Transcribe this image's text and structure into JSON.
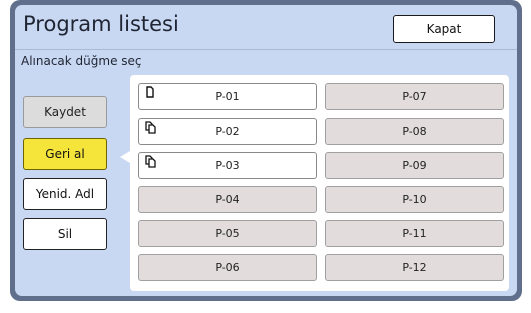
{
  "header": {
    "title": "Program listesi",
    "close_label": "Kapat"
  },
  "instruction": "Alınacak düğme seç",
  "actions": [
    {
      "label": "Kaydet",
      "state": "disabled"
    },
    {
      "label": "Geri al",
      "state": "active"
    },
    {
      "label": "Yenid. Adl",
      "state": "normal"
    },
    {
      "label": "Sil",
      "state": "normal"
    }
  ],
  "programs": [
    {
      "label": "P-01",
      "icon": "single-page-icon"
    },
    {
      "label": "P-02",
      "icon": "multi-page-icon"
    },
    {
      "label": "P-03",
      "icon": "multi-page-icon"
    },
    {
      "label": "P-04",
      "icon": ""
    },
    {
      "label": "P-05",
      "icon": ""
    },
    {
      "label": "P-06",
      "icon": ""
    },
    {
      "label": "P-07",
      "icon": ""
    },
    {
      "label": "P-08",
      "icon": ""
    },
    {
      "label": "P-09",
      "icon": ""
    },
    {
      "label": "P-10",
      "icon": ""
    },
    {
      "label": "P-11",
      "icon": ""
    },
    {
      "label": "P-12",
      "icon": ""
    }
  ],
  "colors": {
    "panel": "#c9d8f2",
    "active_button": "#f5e43a",
    "empty_slot": "#e3dcdc"
  }
}
